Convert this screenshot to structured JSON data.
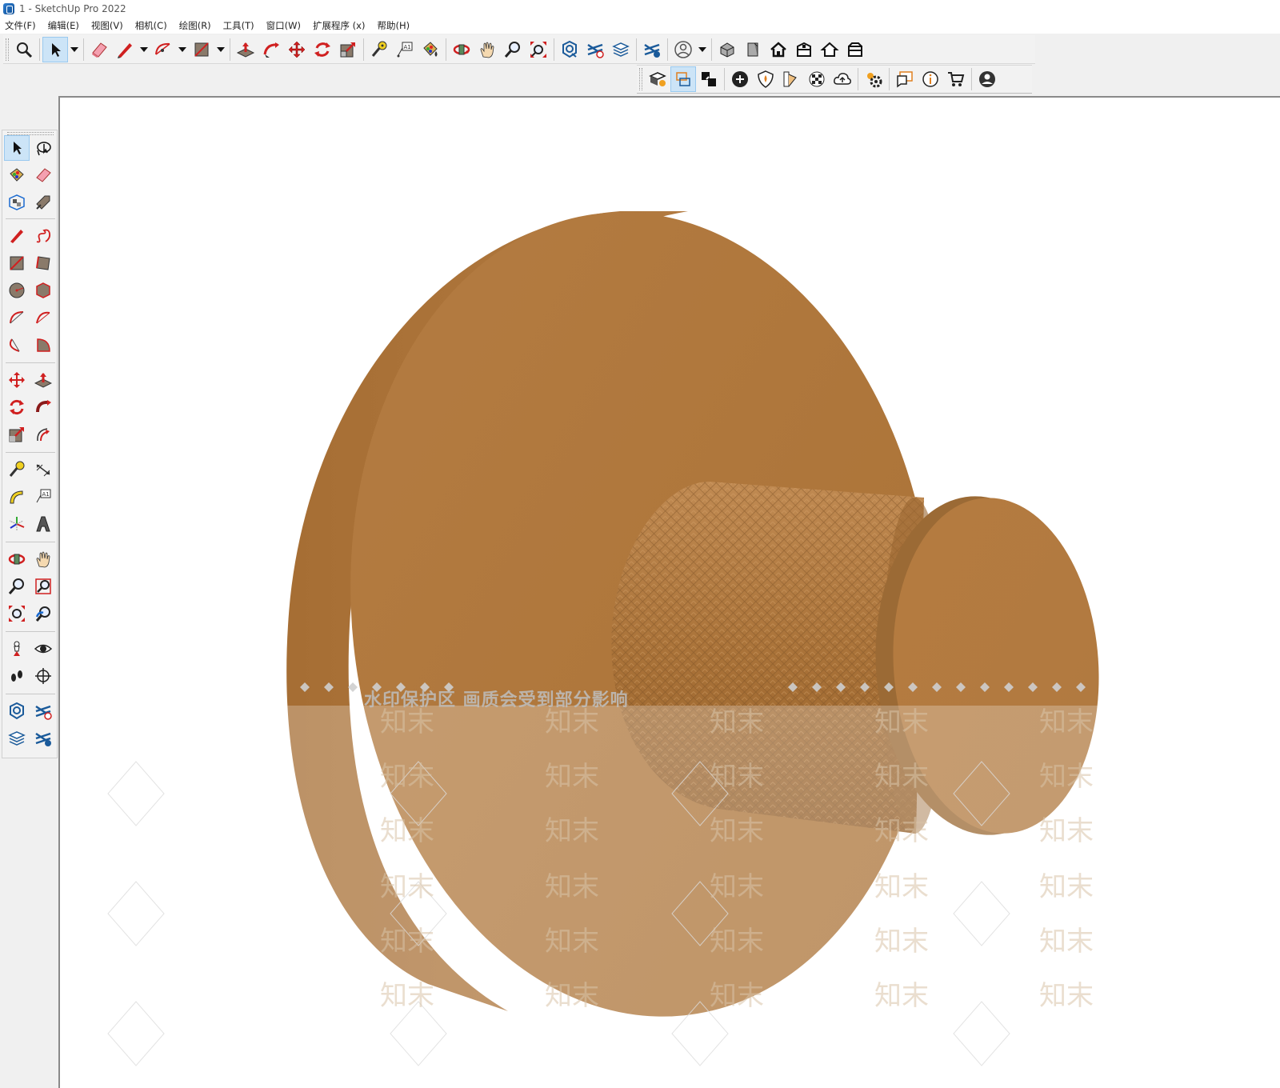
{
  "window": {
    "title": "1 - SketchUp Pro 2022"
  },
  "menu": [
    "文件(F)",
    "编辑(E)",
    "视图(V)",
    "相机(C)",
    "绘图(R)",
    "工具(T)",
    "窗口(W)",
    "扩展程序 (x)",
    "帮助(H)"
  ],
  "toolbar_icons": [
    "search-icon",
    "select-arrow-icon",
    "eraser-icon",
    "pencil-line-icon",
    "arc-icon",
    "rectangle-icon",
    "push-pull-icon",
    "follow-me-icon",
    "move-icon",
    "rotate-icon",
    "scale-icon",
    "tape-measure-icon",
    "text-label-icon",
    "paint-bucket-icon",
    "orbit-icon",
    "pan-hand-icon",
    "zoom-icon",
    "zoom-extents-icon",
    "warehouse-icon",
    "extension-warehouse-icon",
    "layout-icon",
    "component-sync-icon",
    "user-account-icon",
    "iso-view-icon",
    "front-view-icon",
    "home-view-icon",
    "top-view-icon",
    "back-view-icon",
    "right-view-icon"
  ],
  "viewport": {
    "watermark_notice": "水印保护区  画质会受到部分影响",
    "watermark_tile": "知末",
    "model_color": "#b07a40"
  }
}
